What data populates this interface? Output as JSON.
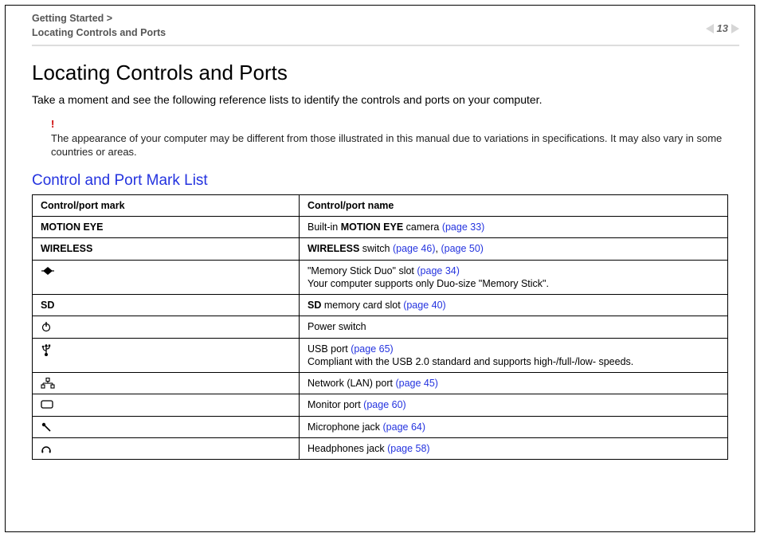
{
  "breadcrumb": {
    "line1": "Getting Started >",
    "line2": "Locating Controls and Ports"
  },
  "pagenum": "13",
  "title": "Locating Controls and Ports",
  "intro": "Take a moment and see the following reference lists to identify the controls and ports on your computer.",
  "note": {
    "bang": "!",
    "text": "The appearance of your computer may be different from those illustrated in this manual due to variations in specifications. It may also vary in some countries or areas."
  },
  "subhead": "Control and Port Mark List",
  "table": {
    "head": {
      "mark": "Control/port mark",
      "name": "Control/port name"
    },
    "rows": {
      "motion_eye": {
        "mark": "MOTION EYE",
        "prefix": "Built-in ",
        "bold": "MOTION EYE",
        "mid": " camera ",
        "link": "(page 33)"
      },
      "wireless": {
        "mark": "WIRELESS",
        "bold": "WIRELESS",
        "mid": " switch ",
        "link1": "(page 46)",
        "sep": ", ",
        "link2": "(page 50)"
      },
      "memstick": {
        "line1pre": "\"Memory Stick Duo\" slot ",
        "link": "(page 34)",
        "line2": "Your computer supports only Duo-size \"Memory Stick\"."
      },
      "sd": {
        "mark": "SD",
        "bold": "SD",
        "mid": " memory card slot ",
        "link": "(page 40)"
      },
      "power": {
        "name": "Power switch"
      },
      "usb": {
        "line1pre": "USB port ",
        "link": "(page 65)",
        "line2": "Compliant with the USB 2.0 standard and supports high-/full-/low- speeds."
      },
      "lan": {
        "pre": "Network (LAN) port ",
        "link": "(page 45)"
      },
      "monitor": {
        "pre": "Monitor port ",
        "link": "(page 60)"
      },
      "mic": {
        "pre": "Microphone jack ",
        "link": "(page 64)"
      },
      "hp": {
        "pre": "Headphones jack ",
        "link": "(page 58)"
      }
    }
  }
}
